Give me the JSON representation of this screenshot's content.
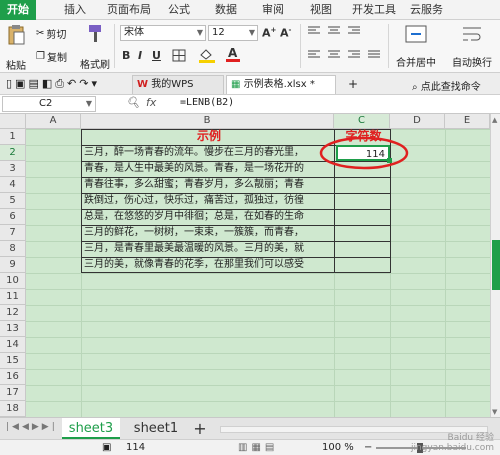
{
  "menu_tabs": [
    "开始",
    "插入",
    "页面布局",
    "公式",
    "数据",
    "审阅",
    "视图",
    "开发工具",
    "云服务"
  ],
  "ribbon": {
    "cut": "剪切",
    "copy": "复制",
    "paste": "粘贴",
    "format_painter": "格式刷",
    "font_name": "宋体",
    "font_size": "12",
    "bold": "B",
    "italic": "I",
    "underline": "U",
    "merge_center": "合并居中",
    "wrap_text": "自动换行"
  },
  "quick_bar": {
    "my_wps_tab": "我的WPS",
    "doc_tab": "示例表格.xlsx *",
    "search": "点此查找命令"
  },
  "formula_bar": {
    "name_box": "C2",
    "fx": "fx",
    "formula": "=LENB(B2)"
  },
  "columns": [
    "A",
    "B",
    "C",
    "D",
    "E"
  ],
  "rows": [
    "1",
    "2",
    "3",
    "4",
    "5",
    "6",
    "7",
    "8",
    "9",
    "10",
    "11",
    "12",
    "13",
    "14",
    "15",
    "16",
    "17",
    "18"
  ],
  "sheet": {
    "b1_title": "示例",
    "c1_title": "字符数",
    "c2_value": "114",
    "b_lines": [
      "三月，醉一场青春的流年。慢步在三月的春光里，",
      "青春，是人生中最美的风景。青春，是一场花开的",
      "青春往事，多么甜蜜；青春岁月，多么靓丽；青春",
      "跌倒过，伤心过，快乐过，痛苦过，孤独过，彷徨",
      "总是，在悠悠的岁月中徘徊；总是，在如春的生命",
      "三月的鲜花，一树树，一束束，一簇簇，而青春，",
      "三月，是青春里最美最温暖的风景。三月的美，就",
      "三月的美，就像青春的花季，在那里我们可以感受"
    ]
  },
  "sheets": [
    "sheet3",
    "sheet1"
  ],
  "add_sheet": "+",
  "status": {
    "value": "114",
    "zoom": "100 %"
  },
  "watermark": "Baidu 经验\njingyan.baidu.com",
  "colors": {
    "accent": "#1e9e4a",
    "grid_bg": "#cfe8cf",
    "title_red": "#e02020",
    "circle_red": "#e02020"
  }
}
